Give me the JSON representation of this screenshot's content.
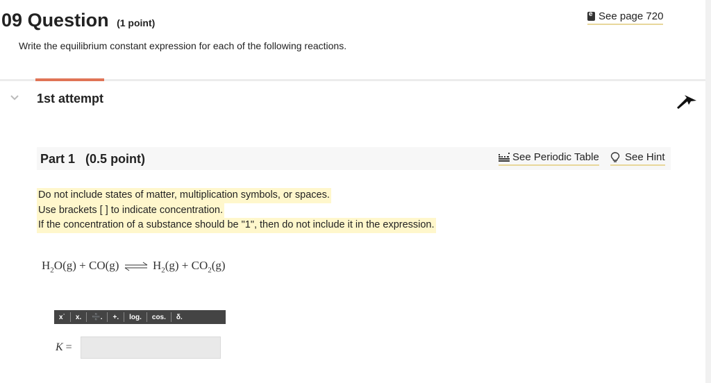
{
  "question": {
    "number": "09",
    "title": "Question",
    "points": "(1 point)",
    "see_page": "See page 720",
    "instructions": "Write the equilibrium constant expression for each of the following reactions."
  },
  "attempt": {
    "label": "1st attempt"
  },
  "part": {
    "title": "Part 1",
    "points": "(0.5 point)",
    "periodic_table_link": "See Periodic Table",
    "hint_link": "See Hint"
  },
  "notes": [
    "Do not include states of matter, multiplication symbols, or spaces.",
    "Use brackets [ ] to indicate concentration.",
    "If the concentration of a substance should be \"1\", then do not include it in the expression."
  ],
  "equation": {
    "r1_a": "H",
    "r1_sub": "2",
    "r1_b": "O",
    "state1": "(g)",
    "plus1": "+",
    "r2": "CO",
    "state2": "(g)",
    "p1_a": "H",
    "p1_sub": "2",
    "state3": "(g)",
    "plus2": "+",
    "p2_a": "CO",
    "p2_sub": "2",
    "state4": "(g)"
  },
  "toolbar": {
    "superscript": "x˙",
    "subscript": "x.",
    "fraction": "➗.",
    "plusminus": "+.",
    "log": "log.",
    "cos": "cos.",
    "delta": "δ."
  },
  "answer": {
    "label_var": "K",
    "label_eq": "=",
    "value": ""
  },
  "colors": {
    "accent": "#e07456",
    "highlight": "#fff7cc",
    "link_underline": "#e8d79a",
    "toolbar": "#444444"
  },
  "icons": {
    "see_page": "book-icon",
    "periodic": "table-icon",
    "hint": "lightbulb-icon",
    "collapse": "chevron-down-icon",
    "flag": "flag-icon"
  }
}
